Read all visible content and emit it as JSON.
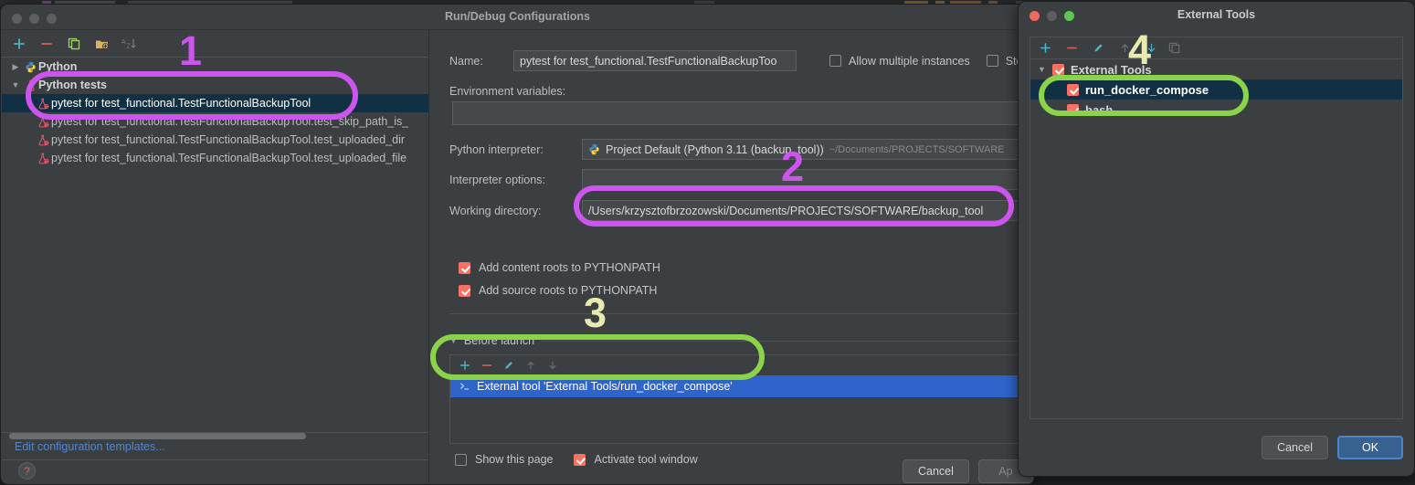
{
  "background_strip": {
    "present": true
  },
  "run_debug_window": {
    "title": "Run/Debug Configurations",
    "traffic_lights": [
      "close-gray",
      "minimize-gray",
      "zoom-gray"
    ],
    "tree_toolbar": [
      {
        "name": "add-icon",
        "glyph": "+"
      },
      {
        "name": "remove-icon",
        "glyph": "−"
      },
      {
        "name": "copy-icon",
        "glyph": "copy"
      },
      {
        "name": "folder-add-icon",
        "glyph": "folder+"
      },
      {
        "name": "sort-alphabetically-icon",
        "glyph": "AZ"
      }
    ],
    "tree": [
      {
        "label": "Python",
        "type": "group",
        "expanded": false,
        "icon": "python-icon",
        "selected": false,
        "indent": 0
      },
      {
        "label": "Python tests",
        "type": "group",
        "expanded": true,
        "icon": "test-flask-icon",
        "selected": false,
        "indent": 0
      },
      {
        "label": "pytest for test_functional.TestFunctionalBackupTool",
        "type": "item",
        "icon": "pytest-icon",
        "selected": true,
        "indent": 1
      },
      {
        "label": "pytest for test_functional.TestFunctionalBackupTool.test_skip_path_is_",
        "type": "item",
        "icon": "pytest-icon",
        "selected": false,
        "indent": 1
      },
      {
        "label": "pytest for test_functional.TestFunctionalBackupTool.test_uploaded_dir",
        "type": "item",
        "icon": "pytest-icon",
        "selected": false,
        "indent": 1
      },
      {
        "label": "pytest for test_functional.TestFunctionalBackupTool.test_uploaded_file",
        "type": "item",
        "icon": "pytest-icon",
        "selected": false,
        "indent": 1
      }
    ],
    "edit_templates_link": "Edit configuration templates...",
    "help_button": "?",
    "form": {
      "name_label": "Name:",
      "name_value": "pytest for test_functional.TestFunctionalBackupToo",
      "allow_multiple_instances": {
        "label": "Allow multiple instances",
        "checked": false
      },
      "store_as_project_file": {
        "label": "Sto",
        "checked": false
      },
      "env_vars_label": "Environment variables:",
      "env_vars_value": "",
      "python_interpreter_label": "Python interpreter:",
      "python_interpreter_value": "Project Default (Python 3.11 (backup_tool))",
      "python_interpreter_path": "~/Documents/PROJECTS/SOFTWARE",
      "interpreter_options_label": "Interpreter options:",
      "interpreter_options_value": "",
      "working_directory_label": "Working directory:",
      "working_directory_value": "/Users/krzysztofbrzozowski/Documents/PROJECTS/SOFTWARE/backup_tool",
      "add_content_roots": {
        "label": "Add content roots to PYTHONPATH",
        "checked": true
      },
      "add_source_roots": {
        "label": "Add source roots to PYTHONPATH",
        "checked": true
      }
    },
    "before_launch": {
      "section_label": "Before launch",
      "expanded": true,
      "toolbar": [
        {
          "name": "add-icon",
          "glyph": "+"
        },
        {
          "name": "remove-icon",
          "glyph": "−"
        },
        {
          "name": "edit-pencil-icon",
          "glyph": "pencil"
        },
        {
          "name": "move-up-icon",
          "glyph": "↑"
        },
        {
          "name": "move-down-icon",
          "glyph": "↓"
        }
      ],
      "items": [
        {
          "label": "External tool 'External Tools/run_docker_compose'",
          "icon": "terminal-prompt-icon",
          "selected": true
        }
      ],
      "show_this_page": {
        "label": "Show this page",
        "checked": false
      },
      "activate_tool_window": {
        "label": "Activate tool window",
        "checked": true
      }
    },
    "buttons": {
      "cancel": "Cancel",
      "apply": "Ap"
    }
  },
  "external_tools_window": {
    "title": "External Tools",
    "traffic_lights": [
      "close-red",
      "minimize-gray",
      "zoom-green"
    ],
    "toolbar": [
      {
        "name": "add-icon",
        "glyph": "+"
      },
      {
        "name": "remove-icon",
        "glyph": "−"
      },
      {
        "name": "edit-pencil-icon",
        "glyph": "pencil"
      },
      {
        "name": "move-up-icon",
        "glyph": "↑"
      },
      {
        "name": "move-down-icon",
        "glyph": "↓"
      },
      {
        "name": "copy-icon",
        "glyph": "copy"
      }
    ],
    "tree": [
      {
        "label": "External Tools",
        "checked": true,
        "expanded": true,
        "indent": 0,
        "selected": false,
        "bold": true
      },
      {
        "label": "run_docker_compose",
        "checked": true,
        "indent": 1,
        "selected": true,
        "bold": true
      },
      {
        "label": "bash",
        "checked": true,
        "indent": 1,
        "selected": false,
        "bold": true
      }
    ],
    "buttons": {
      "cancel": "Cancel",
      "ok": "OK"
    }
  },
  "annotations": [
    {
      "number": "1",
      "color": "#cc55ee",
      "shape": "ellipse-ring"
    },
    {
      "number": "2",
      "color": "#cc55ee",
      "shape": "ellipse-ring"
    },
    {
      "number": "3",
      "color": "#e8ebb0",
      "shape": "ellipse-ring-green"
    },
    {
      "number": "4",
      "color": "#e8ebb0",
      "shape": "ellipse-ring-green"
    }
  ],
  "colors": {
    "window_bg": "#3c3f41",
    "selection_tree": "#123044",
    "selection_blue": "#2f65cb",
    "checkbox_on": "#f87264",
    "link_blue": "#4d87d1",
    "annotation_magenta": "#cc55ee",
    "annotation_green": "#8bd34a",
    "annotation_number_yellow": "#e8ebb0"
  }
}
